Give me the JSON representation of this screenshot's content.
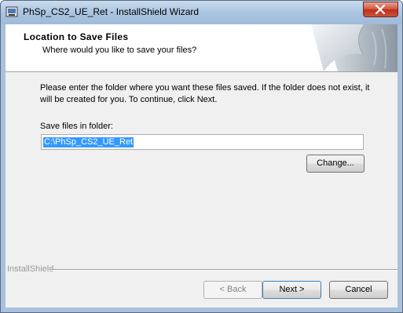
{
  "window": {
    "title": "PhSp_CS2_UE_Ret - InstallShield Wizard"
  },
  "header": {
    "title": "Location to Save Files",
    "subtitle": "Where would you like to save your files?"
  },
  "body": {
    "instructions": "Please enter the folder where you want these files saved.  If the folder does not exist, it will be created for you.   To continue, click Next.",
    "folder_label": "Save files in folder:",
    "folder_value": "C:\\PhSp_CS2_UE_Ret",
    "change_label": "Change..."
  },
  "footer": {
    "brand": "InstallShield",
    "back_label": "< Back",
    "next_label": "Next >",
    "cancel_label": "Cancel"
  },
  "icons": {
    "app": "installer-icon",
    "close": "close-icon",
    "header": "page-curl-graphic"
  }
}
